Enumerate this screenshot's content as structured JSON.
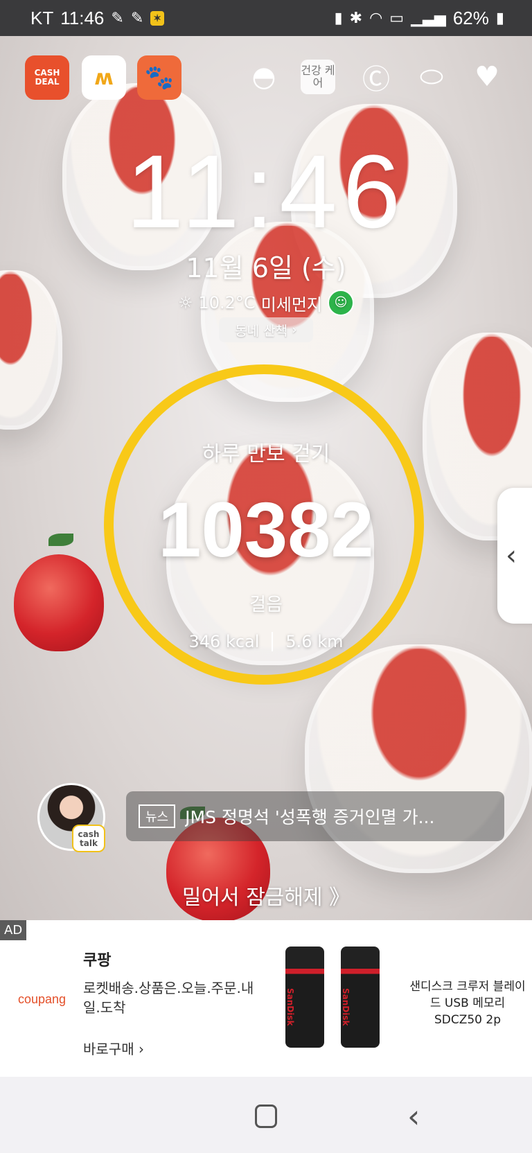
{
  "status_bar": {
    "carrier": "KT",
    "time": "11:46",
    "battery": "62%"
  },
  "top_apps": {
    "cashdeal_label": "CASH DEAL",
    "care_label": "건강 케어"
  },
  "lock": {
    "time": "11:46",
    "date": "11월 6일 (수)",
    "temperature": "10.2°C",
    "dust_label": "미세먼지",
    "walk_button": "동네 산책",
    "ring_title": "하루 만보 걷기",
    "steps": "10382",
    "steps_unit": "걸음",
    "kcal": "346 kcal",
    "distance": "5.6 km",
    "step_goal_progress": 1.0,
    "ring_color": "#f8c918"
  },
  "cashtalk": {
    "badge": "cash talk"
  },
  "news": {
    "tag": "뉴스",
    "headline": "JMS 정명석 '성폭행 증거인멸 가..."
  },
  "unlock_text": "밀어서 잠금해제 》",
  "ad": {
    "badge": "AD",
    "logo": "coupang",
    "title": "쿠팡",
    "desc": "로켓배송.상품은.오늘.주문.내일.도착",
    "cta": "바로구매",
    "product": "샌디스크 크루저 블레이드 USB 메모리 SDCZ50 2p",
    "usb_brand": "SanDisk"
  }
}
